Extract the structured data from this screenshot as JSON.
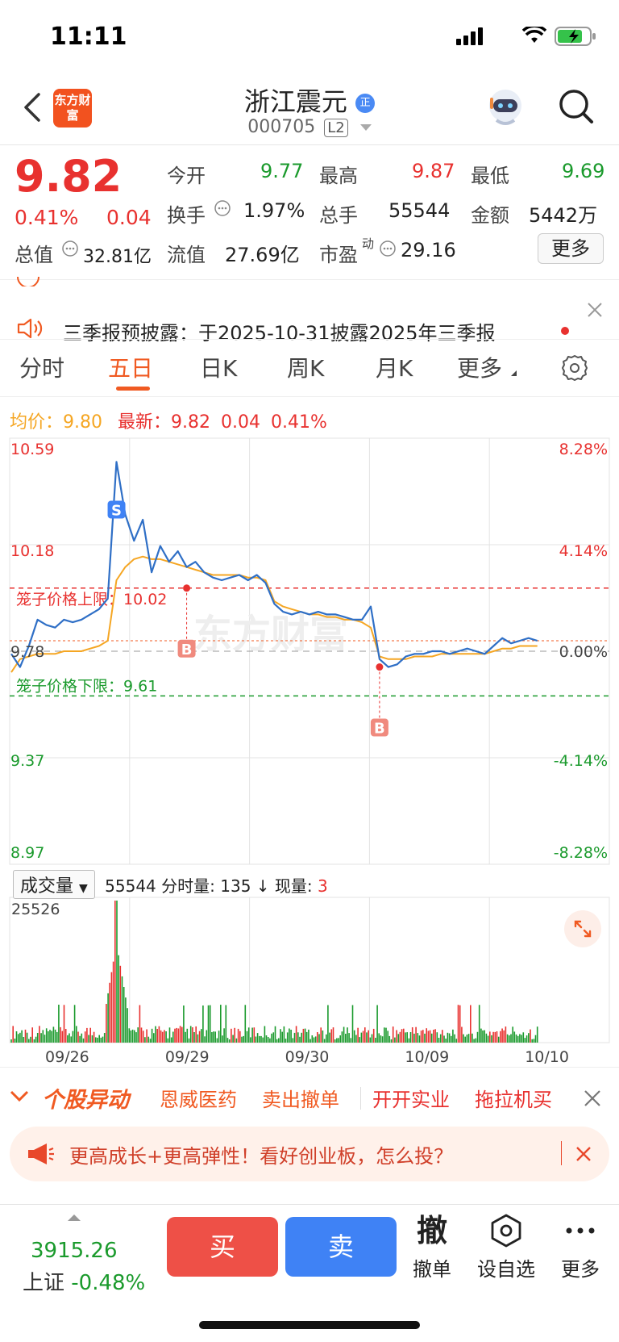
{
  "status_bar": {
    "time": "11:11"
  },
  "header": {
    "brand_logo_text": "东方财富",
    "stock_name": "浙江震元",
    "stock_code": "000705",
    "level_badge": "L2",
    "name_badge": "正"
  },
  "quote": {
    "price": "9.82",
    "change_pct": "0.41%",
    "change": "0.04",
    "open_label": "今开",
    "open": "9.77",
    "high_label": "最高",
    "high": "9.87",
    "low_label": "最低",
    "low": "9.69",
    "turnover_label": "换手",
    "turnover": "1.97%",
    "volume_label": "总手",
    "volume": "55544",
    "amount_label": "金额",
    "amount": "5442万",
    "mktcap_label": "总值",
    "mktcap": "32.81亿",
    "float_label": "流值",
    "float_cap": "27.69亿",
    "pe_label": "市盈",
    "pe_sup": "动",
    "pe": "29.16",
    "more_button": "更多"
  },
  "notice": {
    "text": "三季报预披露：于2025-10-31披露2025年三季报"
  },
  "tabs": {
    "items": [
      "分时",
      "五日",
      "日K",
      "周K",
      "月K",
      "更多"
    ],
    "active_index": 1
  },
  "avg_line": {
    "avg_label": "均价：",
    "avg_value": "9.80",
    "latest_label": "最新：",
    "latest_value": "9.82",
    "latest_change": "0.04",
    "latest_pct": "0.41%"
  },
  "chart_data": {
    "type": "line",
    "title": "",
    "x_dates": [
      "09/26",
      "09/29",
      "09/30",
      "10/09",
      "10/10"
    ],
    "y_ticks_left": [
      "10.59",
      "10.18",
      "9.78",
      "9.37",
      "8.97"
    ],
    "y_ticks_right": [
      "8.28%",
      "4.14%",
      "0.00%",
      "-4.14%",
      "-8.28%"
    ],
    "ylim": [
      8.97,
      10.59
    ],
    "prev_close": 9.78,
    "watermark": "东方财富",
    "cage_upper_label": "笼子价格上限：10.02",
    "cage_upper": 10.02,
    "cage_lower_label": "笼子价格下限：9.61",
    "cage_lower": 9.61,
    "series": [
      {
        "name": "price",
        "color": "#2f6fc6",
        "values": [
          9.77,
          9.72,
          9.8,
          9.9,
          9.88,
          9.87,
          9.9,
          9.89,
          9.9,
          9.92,
          9.94,
          9.98,
          10.5,
          10.3,
          10.2,
          10.28,
          10.08,
          10.18,
          10.12,
          10.16,
          10.1,
          10.12,
          10.08,
          10.06,
          10.05,
          10.06,
          10.07,
          10.05,
          10.07,
          10.04,
          9.96,
          9.93,
          9.92,
          9.93,
          9.92,
          9.93,
          9.92,
          9.92,
          9.91,
          9.9,
          9.9,
          9.95,
          9.75,
          9.72,
          9.73,
          9.76,
          9.77,
          9.77,
          9.78,
          9.78,
          9.77,
          9.78,
          9.79,
          9.78,
          9.77,
          9.8,
          9.83,
          9.81,
          9.82,
          9.83,
          9.82
        ]
      },
      {
        "name": "average",
        "color": "#f5a623",
        "values": [
          9.7,
          9.75,
          9.76,
          9.77,
          9.77,
          9.77,
          9.78,
          9.78,
          9.78,
          9.79,
          9.8,
          9.82,
          10.05,
          10.1,
          10.13,
          10.14,
          10.13,
          10.13,
          10.12,
          10.11,
          10.1,
          10.09,
          10.08,
          10.07,
          10.07,
          10.07,
          10.07,
          10.06,
          10.06,
          10.05,
          9.97,
          9.95,
          9.94,
          9.93,
          9.92,
          9.92,
          9.91,
          9.91,
          9.9,
          9.9,
          9.89,
          9.87,
          9.76,
          9.75,
          9.75,
          9.75,
          9.76,
          9.76,
          9.76,
          9.77,
          9.77,
          9.77,
          9.77,
          9.77,
          9.77,
          9.78,
          9.79,
          9.79,
          9.8,
          9.8,
          9.8
        ]
      }
    ],
    "markers": [
      {
        "label": "S",
        "x_index": 12,
        "value": 10.3,
        "color": "#3f82f5"
      },
      {
        "label": "B",
        "x_index": 20,
        "value": 10.02,
        "color": "#e8312f"
      },
      {
        "label": "B",
        "x_index": 42,
        "value": 9.72,
        "color": "#e8312f"
      }
    ]
  },
  "volume": {
    "selector_label": "成交量",
    "total": "55544",
    "tick_label": "分时量:",
    "tick_value": "135",
    "now_label": "现量:",
    "now_value": "3",
    "max_label": "25526"
  },
  "alerts": {
    "title": "个股异动",
    "items": [
      "恩威医药",
      "卖出撤单",
      "开开实业",
      "拖拉机买"
    ]
  },
  "promo": {
    "text": "更高成长+更高弹性！看好创业板，怎么投？"
  },
  "bottom": {
    "index_value": "3915.26",
    "index_name": "上证",
    "index_change": "-0.48%",
    "buy": "买",
    "sell": "卖",
    "cancel_icon": "撤",
    "cancel": "撤单",
    "watchlist": "设自选",
    "more": "更多"
  },
  "colors": {
    "up": "#e8312f",
    "down": "#1a9a2c",
    "accent": "#f05a22",
    "price_line": "#2f6fc6",
    "avg_line": "#f5a623"
  }
}
